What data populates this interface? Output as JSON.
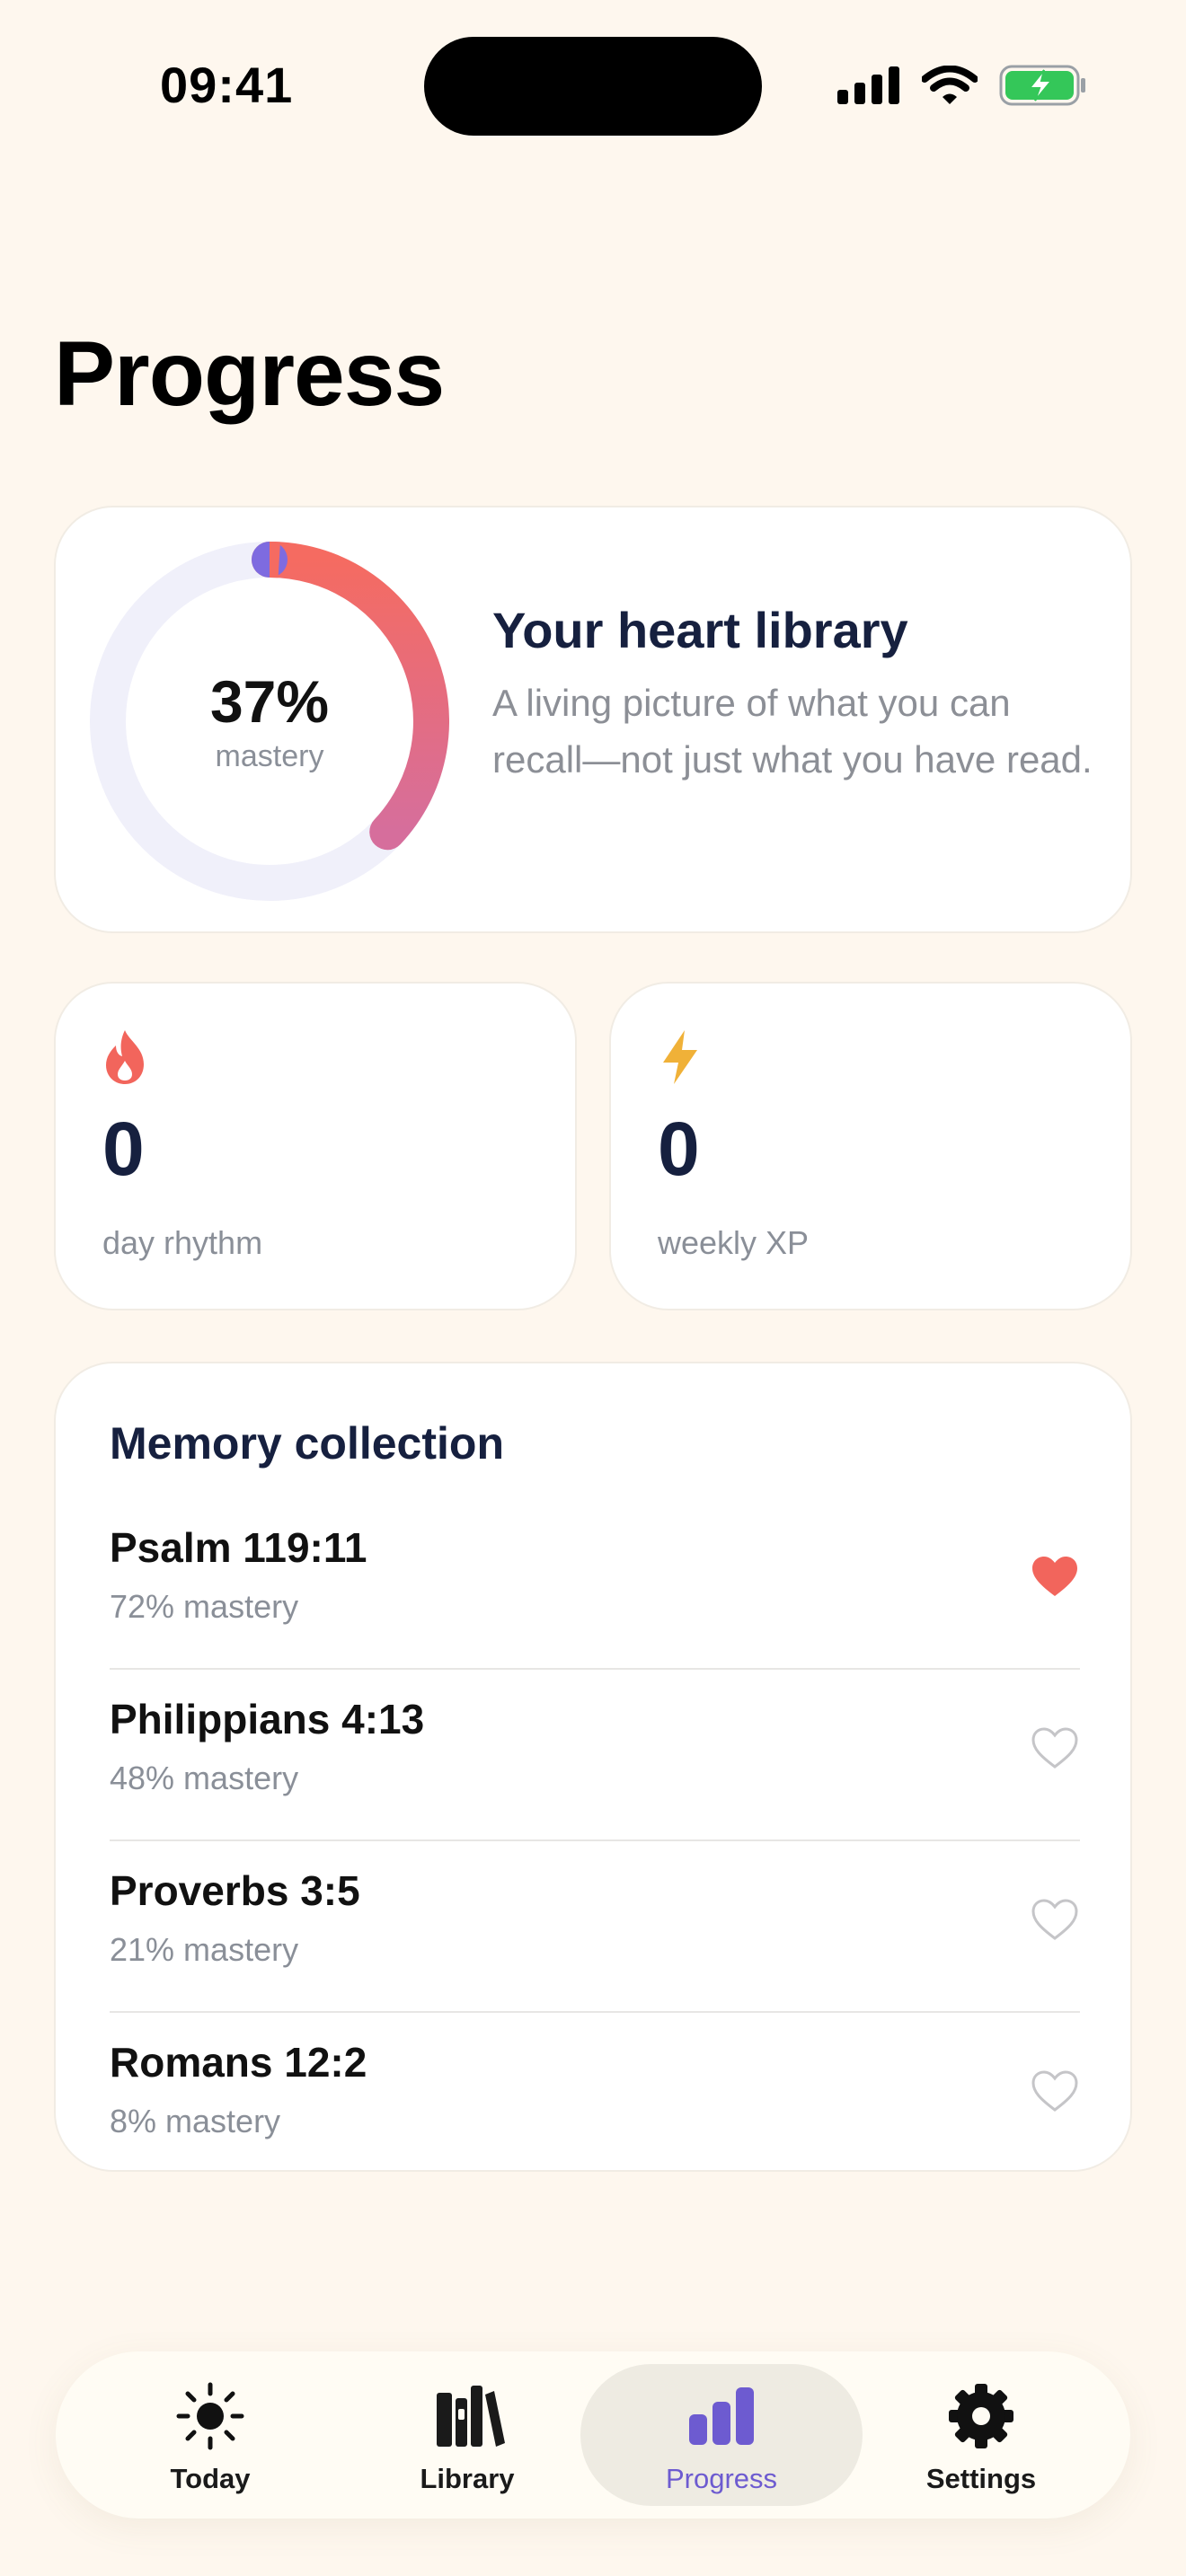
{
  "status_bar": {
    "time": "09:41"
  },
  "page": {
    "title": "Progress"
  },
  "library_card": {
    "mastery_percent": 37,
    "mastery_value": "37%",
    "mastery_label": "mastery",
    "title": "Your heart library",
    "description": "A living picture of what you can recall—not just what you have read."
  },
  "stats": {
    "rhythm": {
      "icon": "flame-icon",
      "value": "0",
      "label": "day rhythm"
    },
    "xp": {
      "icon": "lightning-icon",
      "value": "0",
      "label": "weekly XP"
    }
  },
  "memory": {
    "title": "Memory collection",
    "items": [
      {
        "reference": "Psalm 119:11",
        "mastery": "72% mastery",
        "favorite": true
      },
      {
        "reference": "Philippians 4:13",
        "mastery": "48% mastery",
        "favorite": false
      },
      {
        "reference": "Proverbs 3:5",
        "mastery": "21% mastery",
        "favorite": false
      },
      {
        "reference": "Romans 12:2",
        "mastery": "8% mastery",
        "favorite": false
      }
    ]
  },
  "tabs": [
    {
      "label": "Today",
      "icon": "sun-icon",
      "active": false
    },
    {
      "label": "Library",
      "icon": "books-icon",
      "active": false
    },
    {
      "label": "Progress",
      "icon": "bar-chart-icon",
      "active": true
    },
    {
      "label": "Settings",
      "icon": "gear-icon",
      "active": false
    }
  ],
  "colors": {
    "background": "#FEF7EE",
    "accent": "#6D5BD0",
    "heart_active": "#F2655C",
    "flame": "#F2655C",
    "lightning": "#F0B138",
    "ring_start": "#F56B61",
    "ring_end": "#D66E9C",
    "ring_track": "#F0F0FA"
  }
}
